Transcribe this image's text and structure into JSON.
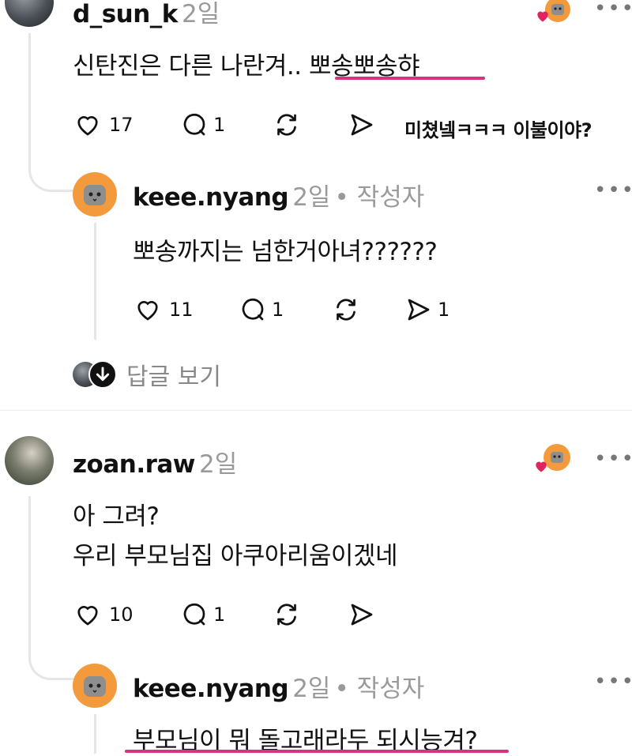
{
  "comments": [
    {
      "username": "d_sun_k",
      "time": "2일",
      "text": "신탄진은 다른 나란겨.. 뽀송뽀송햐",
      "likes": "17",
      "replies": "1",
      "shares": "",
      "annotation": "미쳤넼ㅋㅋㅋ 이불이야?",
      "reply": {
        "username": "keee.nyang",
        "time": "2일",
        "author_badge": "• 작성자",
        "text": "뽀송까지는 넘한거아녀??????",
        "likes": "11",
        "replies": "1",
        "shares": "1"
      },
      "view_replies": "답글 보기"
    },
    {
      "username": "zoan.raw",
      "time": "2일",
      "text_lines": [
        "아 그려?",
        "우리 부모님집 아쿠아리움이겠네"
      ],
      "likes": "10",
      "replies": "1",
      "reply": {
        "username": "keee.nyang",
        "time": "2일",
        "author_badge": "• 작성자",
        "text": "부모님이 뭐 돌고래라두 되시능겨?"
      }
    }
  ],
  "colors": {
    "accent_underline": "#d63384",
    "heart_badge": "#e0245e",
    "cat_avatar": "#f39a3c",
    "muted_text": "#9a9a9a"
  },
  "icons": [
    "heart-icon",
    "comment-icon",
    "repost-icon",
    "send-icon",
    "more-icon",
    "arrow-down-icon"
  ]
}
